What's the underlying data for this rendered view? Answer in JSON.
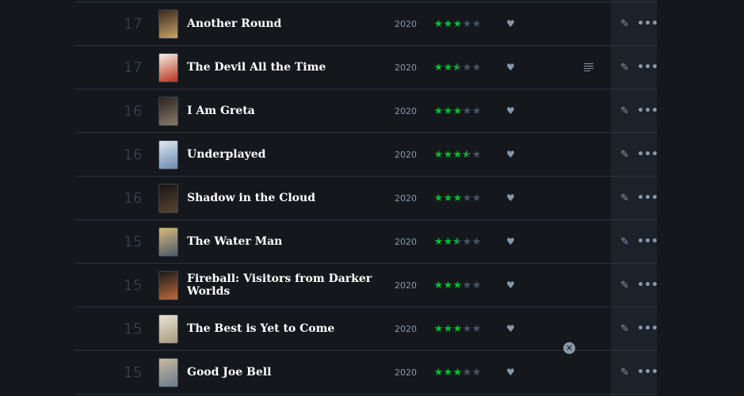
{
  "diary": {
    "entries": [
      {
        "day": "17",
        "title": "Another Round",
        "year": "2020",
        "rating": 3,
        "review": false,
        "poster_colors": [
          "#3a2a1e",
          "#c9a36a"
        ]
      },
      {
        "day": "17",
        "title": "The Devil All the Time",
        "year": "2020",
        "rating": 2.5,
        "review": true,
        "poster_colors": [
          "#f4efe6",
          "#b8321c"
        ]
      },
      {
        "day": "16",
        "title": "I Am Greta",
        "year": "2020",
        "rating": 3,
        "review": false,
        "poster_colors": [
          "#2a2420",
          "#8a7a6a"
        ]
      },
      {
        "day": "16",
        "title": "Underplayed",
        "year": "2020",
        "rating": 3.5,
        "review": false,
        "poster_colors": [
          "#dfe6ee",
          "#6a8ab0"
        ]
      },
      {
        "day": "16",
        "title": "Shadow in the Cloud",
        "year": "2020",
        "rating": 3,
        "review": false,
        "poster_colors": [
          "#1a1412",
          "#5a4434"
        ]
      },
      {
        "day": "15",
        "title": "The Water Man",
        "year": "2020",
        "rating": 2.5,
        "review": false,
        "poster_colors": [
          "#d9b878",
          "#4a5a6a"
        ]
      },
      {
        "day": "15",
        "title": "Fireball: Visitors from Darker Worlds",
        "year": "2020",
        "rating": 3,
        "review": false,
        "poster_colors": [
          "#1a1a1a",
          "#c06a3a"
        ]
      },
      {
        "day": "15",
        "title": "The Best is Yet to Come",
        "year": "2020",
        "rating": 3,
        "review": false,
        "poster_colors": [
          "#e8e2d4",
          "#a89a80"
        ]
      },
      {
        "day": "15",
        "title": "Good Joe Bell",
        "year": "2020",
        "rating": 3,
        "review": false,
        "poster_colors": [
          "#c8b8a0",
          "#6a7a8a"
        ]
      }
    ]
  },
  "icons": {
    "like": "heart-icon",
    "edit": "pencil-icon",
    "more": "more-icon",
    "review": "review-text-icon",
    "close": "close-icon"
  },
  "colors": {
    "background": "#14181c",
    "star_on": "#00c030",
    "star_off": "#445566",
    "muted": "#8899aa",
    "actions_column": "#1c222a"
  }
}
